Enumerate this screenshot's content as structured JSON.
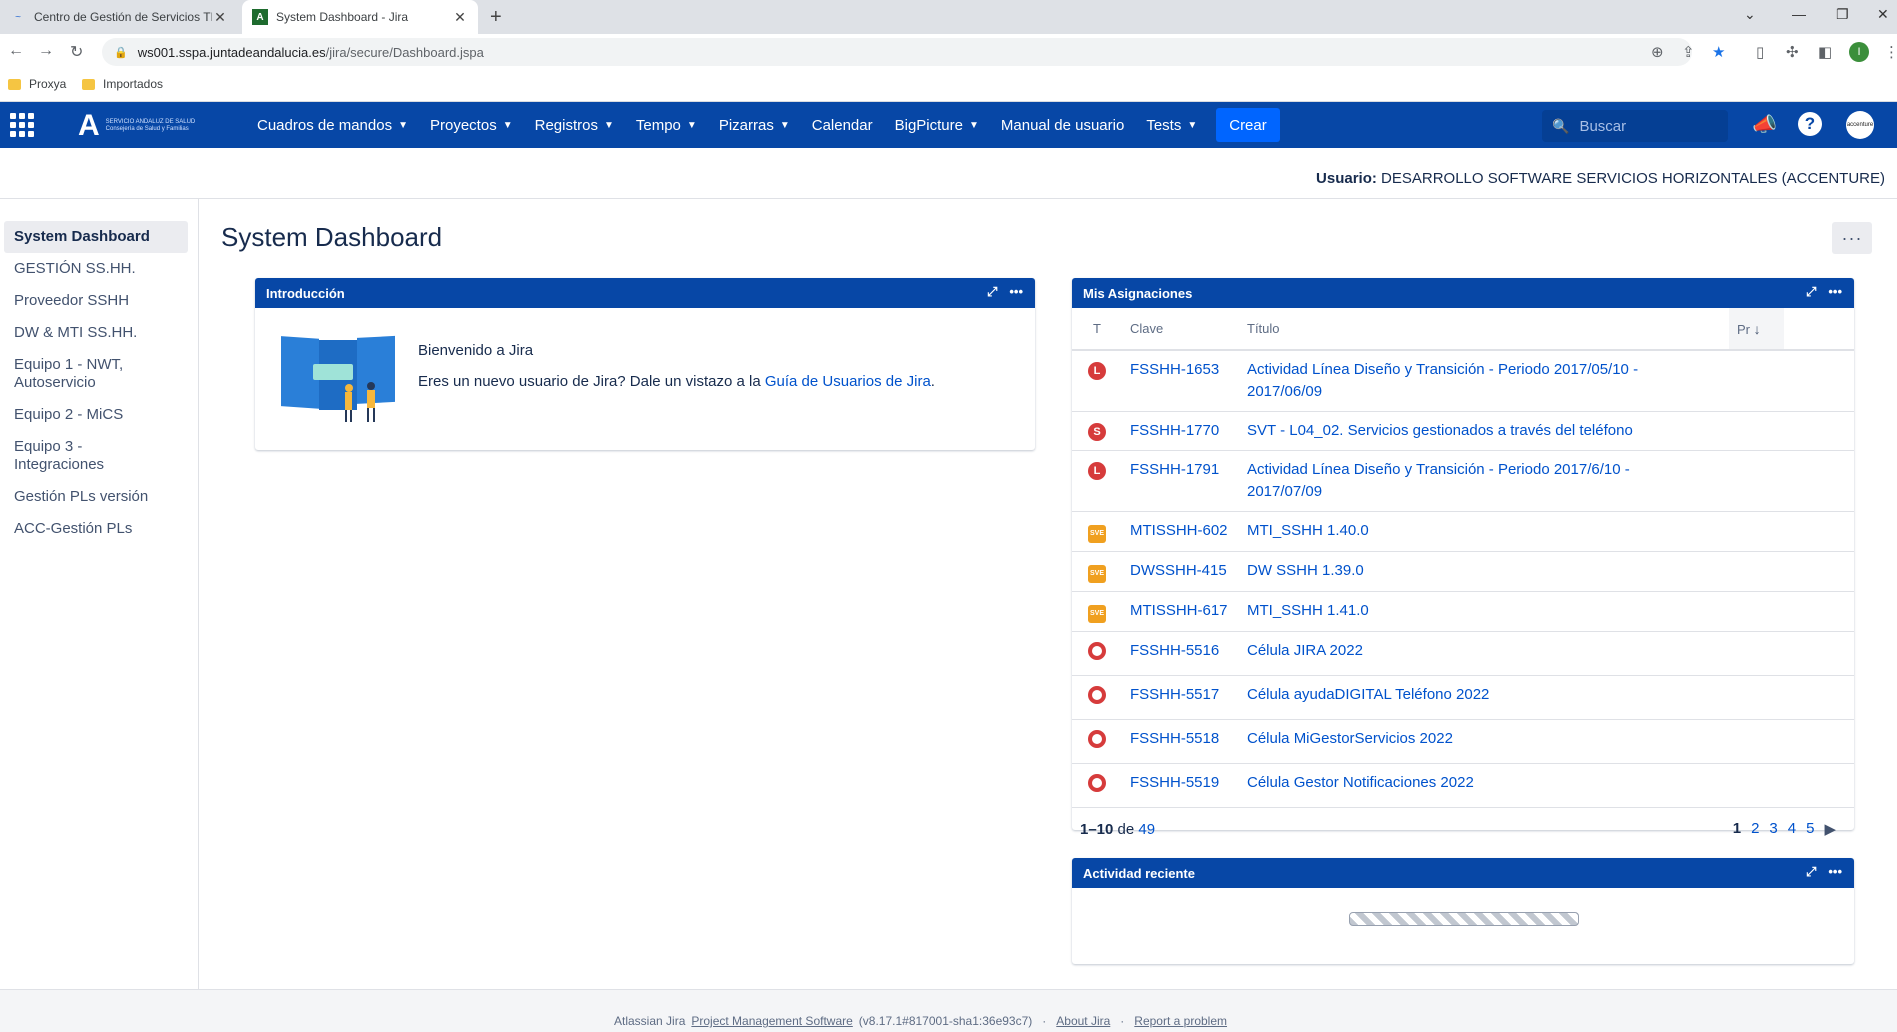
{
  "browser": {
    "tabs": [
      {
        "title": "Centro de Gestión de Servicios TI",
        "active": false
      },
      {
        "title": "System Dashboard - Jira",
        "active": true
      }
    ],
    "url_host": "ws001.sspa.juntadeandalucia.es",
    "url_path": "/jira/secure/Dashboard.jspa",
    "profile_initial": "I",
    "bookmarks": [
      "Proxya",
      "Importados"
    ]
  },
  "jira": {
    "logo_line1": "SERVICIO ANDALUZ DE SALUD",
    "logo_line2": "Consejería de Salud y Familias",
    "nav": {
      "dashboards": "Cuadros de mandos",
      "projects": "Proyectos",
      "records": "Registros",
      "tempo": "Tempo",
      "boards": "Pizarras",
      "calendar": "Calendar",
      "bigpicture": "BigPicture",
      "manual": "Manual de usuario",
      "tests": "Tests",
      "create": "Crear"
    },
    "search_placeholder": "Buscar",
    "avatar_text": "accenture",
    "accent": "#0747a6"
  },
  "userbar": {
    "label": "Usuario:",
    "value": "DESARROLLO SOFTWARE SERVICIOS HORIZONTALES (ACCENTURE)"
  },
  "sidebar": {
    "items": [
      "System Dashboard",
      "GESTIÓN SS.HH.",
      "Proveedor SSHH",
      "DW & MTI SS.HH.",
      "Equipo 1 - NWT, Autoservicio",
      "Equipo 2 - MiCS",
      "Equipo 3 - Integraciones",
      "Gestión PLs versión",
      "ACC-Gestión PLs"
    ]
  },
  "page": {
    "title": "System Dashboard",
    "more": "···"
  },
  "intro": {
    "title": "Introducción",
    "welcome": "Bienvenido a Jira",
    "text_before": "Eres un nuevo usuario de Jira? Dale un vistazo a la ",
    "link": "Guía de Usuarios de Jira",
    "text_after": "."
  },
  "assignments": {
    "title": "Mis Asignaciones",
    "columns": {
      "type": "T",
      "key": "Clave",
      "title": "Título",
      "priority": "Pr"
    },
    "rows": [
      {
        "icon": "L",
        "key": "FSSHH-1653",
        "title": "Actividad Línea Diseño y Transición - Periodo 2017/05/10 - 2017/06/09"
      },
      {
        "icon": "S",
        "key": "FSSHH-1770",
        "title": "SVT - L04_02. Servicios gestionados a través del teléfono"
      },
      {
        "icon": "L",
        "key": "FSSHH-1791",
        "title": "Actividad Línea Diseño y Transición - Periodo 2017/6/10 - 2017/07/09"
      },
      {
        "icon": "SVE",
        "key": "MTISSHH-602",
        "title": "MTI_SSHH 1.40.0"
      },
      {
        "icon": "SVE",
        "key": "DWSSHH-415",
        "title": "DW SSHH 1.39.0"
      },
      {
        "icon": "SVE",
        "key": "MTISSHH-617",
        "title": "MTI_SSHH 1.41.0"
      },
      {
        "icon": "O",
        "key": "FSSHH-5516",
        "title": "Célula JIRA 2022"
      },
      {
        "icon": "O",
        "key": "FSSHH-5517",
        "title": "Célula ayudaDIGITAL Teléfono 2022"
      },
      {
        "icon": "O",
        "key": "FSSHH-5518",
        "title": "Célula MiGestorServicios 2022"
      },
      {
        "icon": "O",
        "key": "FSSHH-5519",
        "title": "Célula Gestor Notificaciones 2022"
      }
    ],
    "range": "1–10",
    "of": "de",
    "total": "49",
    "pages": [
      "1",
      "2",
      "3",
      "4",
      "5"
    ],
    "current_page": "1"
  },
  "activity": {
    "title": "Actividad reciente"
  },
  "footer": {
    "prefix": "Atlassian Jira",
    "link1": "Project Management Software",
    "version": "(v8.17.1#817001-sha1:36e93c7)",
    "sep": "·",
    "link2": "About Jira",
    "link3": "Report a problem"
  }
}
